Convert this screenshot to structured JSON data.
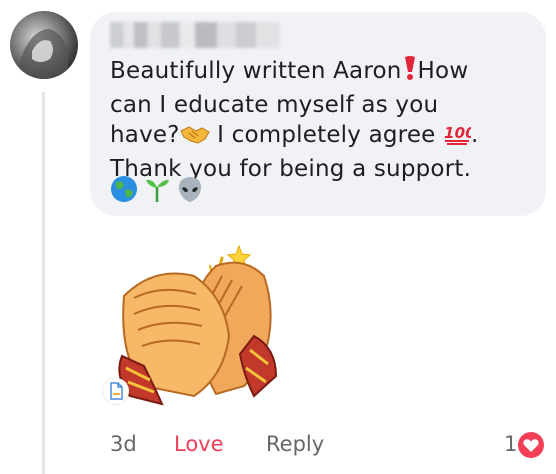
{
  "comment": {
    "text_line1": "Beautifully written Aaron",
    "text_line1b": "How",
    "text_line2": "can I educate myself as you",
    "text_line3a": "have?",
    "text_line3b": " I completely agree ",
    "text_line3c": ".",
    "text_line4": "Thank you for being a support."
  },
  "actions": {
    "time": "3d",
    "reaction_label": "Love",
    "reply_label": "Reply"
  },
  "reactions": {
    "count": "1",
    "type": "heart-icon"
  },
  "icons": {
    "exclamation": "red-exclamation-icon",
    "handshake": "handshake-icon",
    "hundred": "hundred-points-icon",
    "globe": "globe-icon",
    "seedling": "seedling-icon",
    "alien": "alien-icon",
    "sticker": "clapping-hands-sticker"
  },
  "colors": {
    "bubble": "#f0f2f5",
    "love": "#f33e58",
    "meta": "#65676b"
  }
}
